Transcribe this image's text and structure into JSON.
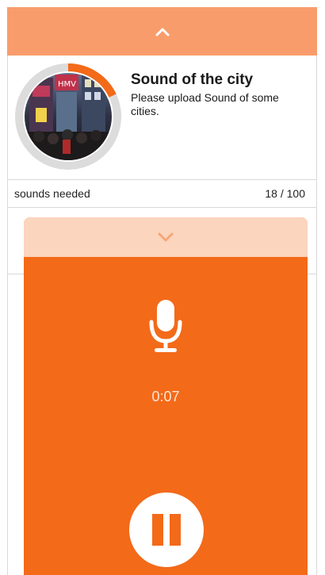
{
  "header": {
    "collapse_icon": "chevron-up-icon"
  },
  "project": {
    "title": "Sound of the city",
    "description": "Please upload Sound of some cities.",
    "image_icon": "city-street-photo",
    "progress_fraction": 0.18
  },
  "stats": {
    "label": "sounds needed",
    "count": "18 / 100"
  },
  "recorder": {
    "collapse_icon": "chevron-down-icon",
    "mic_icon": "microphone-icon",
    "timer": "0:07",
    "pause_icon": "pause-icon"
  },
  "colors": {
    "accent": "#f36a19",
    "accent_light": "#f99c6c",
    "accent_pale": "#fbd5bd",
    "progress": "#f36a19",
    "track": "#dcdcdc"
  }
}
